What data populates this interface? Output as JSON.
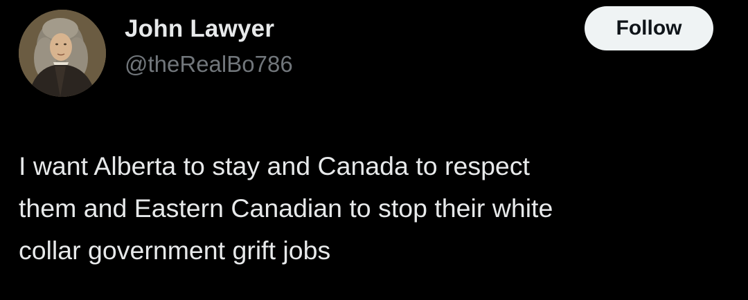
{
  "author": {
    "display_name": "John Lawyer",
    "handle": "@theRealBo786",
    "avatar_icon": "portrait-avatar-icon"
  },
  "follow_button": {
    "label": "Follow"
  },
  "tweet": {
    "text": "I want Alberta to stay and Canada to respect\nthem and Eastern Canadian to stop their white\ncollar government grift jobs"
  },
  "colors": {
    "background": "#000000",
    "text_primary": "#e7e9ea",
    "text_secondary": "#71767b",
    "button_bg": "#eff3f4",
    "button_text": "#0f1419"
  }
}
